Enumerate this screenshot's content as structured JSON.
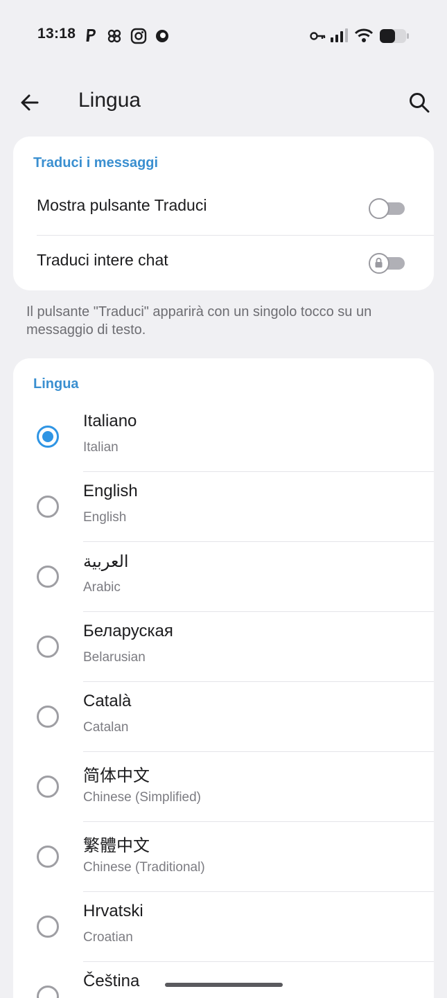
{
  "status": {
    "time": "13:18"
  },
  "header": {
    "title": "Lingua"
  },
  "translate": {
    "section_title": "Traduci i messaggi",
    "show_button_label": "Mostra pulsante Traduci",
    "show_button_on": false,
    "whole_chats_label": "Traduci intere chat",
    "whole_chats_locked": true,
    "note": "Il pulsante \"Traduci\" apparirà con un singolo tocco su un messaggio di testo."
  },
  "language": {
    "section_title": "Lingua",
    "selected": "Italiano",
    "items": [
      {
        "name": "Italiano",
        "sub": "Italian"
      },
      {
        "name": "English",
        "sub": "English"
      },
      {
        "name": "العربية",
        "sub": "Arabic"
      },
      {
        "name": "Беларуская",
        "sub": "Belarusian"
      },
      {
        "name": "Català",
        "sub": "Catalan"
      },
      {
        "name": "简体中文",
        "sub": "Chinese (Simplified)"
      },
      {
        "name": "繁體中文",
        "sub": "Chinese (Traditional)"
      },
      {
        "name": "Hrvatski",
        "sub": "Croatian"
      },
      {
        "name": "Čeština",
        "sub": ""
      }
    ]
  },
  "colors": {
    "accent": "#2f95e4",
    "section": "#3a8fd0",
    "background": "#f0f0f3"
  }
}
